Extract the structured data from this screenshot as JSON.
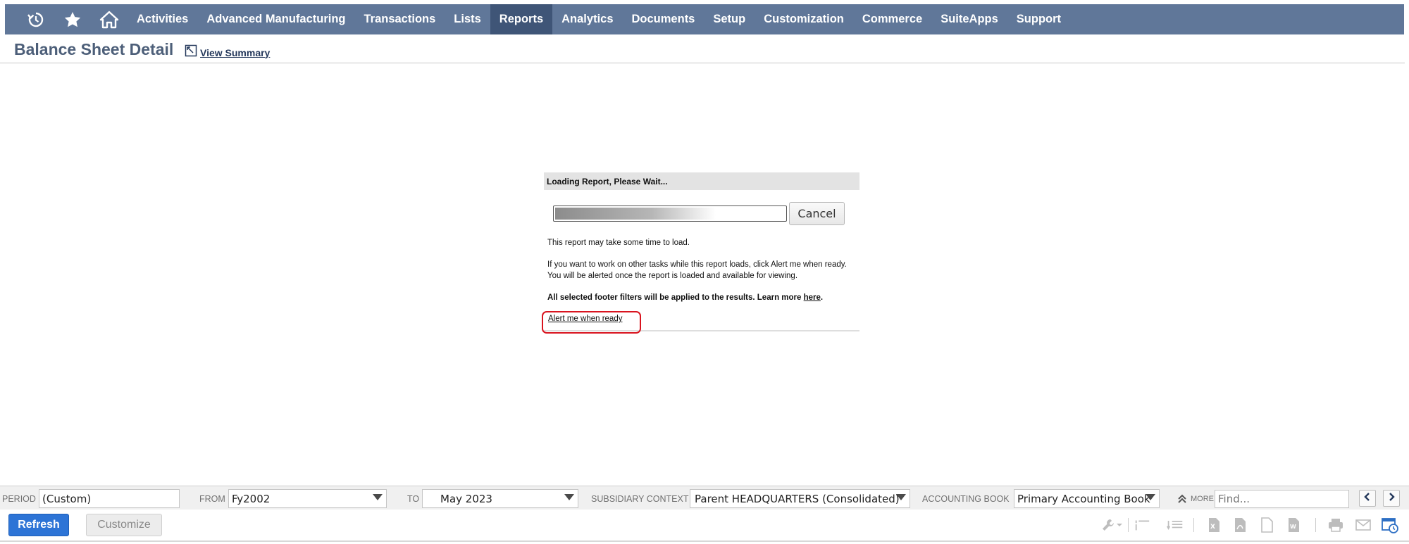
{
  "nav": {
    "icons": [
      "recent-icon",
      "star-icon",
      "home-icon"
    ],
    "items": [
      {
        "label": "Activities"
      },
      {
        "label": "Advanced Manufacturing"
      },
      {
        "label": "Transactions"
      },
      {
        "label": "Lists"
      },
      {
        "label": "Reports",
        "active": true
      },
      {
        "label": "Analytics"
      },
      {
        "label": "Documents"
      },
      {
        "label": "Setup"
      },
      {
        "label": "Customization"
      },
      {
        "label": "Commerce"
      },
      {
        "label": "SuiteApps"
      },
      {
        "label": "Support"
      }
    ],
    "bg_color": "#607799",
    "active_color": "#3f5577"
  },
  "page": {
    "title": "Balance Sheet Detail",
    "view_summary": "View Summary"
  },
  "loading": {
    "header": "Loading Report, Please Wait...",
    "progress": 0.7,
    "cancel": "Cancel",
    "line1": "This report may take some time to load.",
    "line2": "If you want to work on other tasks while this report loads, click Alert me when ready. You will be alerted once the report is loaded and available for viewing.",
    "line3_bold": "All selected footer filters will be applied to the results. Learn more ",
    "line3_link": "here",
    "line3_end": ".",
    "alert_link": "Alert me when ready",
    "highlight_color": "#d9141f"
  },
  "filters": {
    "period_label": "PERIOD",
    "period_value": "(Custom)",
    "from_label": "FROM",
    "from_value": "Fy2002",
    "to_label": "TO",
    "to_value": "May 2023",
    "subsidiary_label": "SUBSIDIARY CONTEXT",
    "subsidiary_value": "Parent HEADQUARTERS (Consolidated)",
    "book_label": "ACCOUNTING BOOK",
    "book_value": "Primary Accounting Book",
    "more_label": "MORE",
    "find_placeholder": "Find..."
  },
  "actions": {
    "refresh": "Refresh",
    "customize": "Customize",
    "refresh_color": "#2d74d6"
  }
}
